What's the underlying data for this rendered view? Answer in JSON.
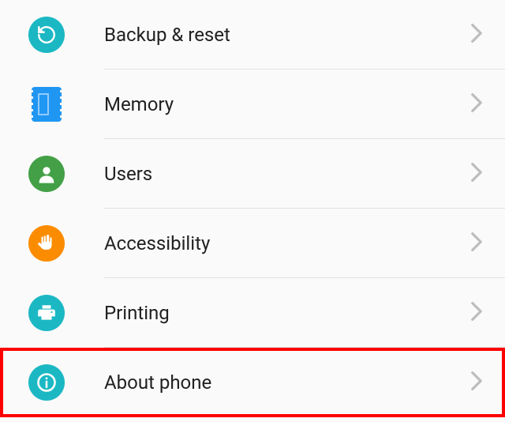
{
  "settings": {
    "items": [
      {
        "key": "backup-reset",
        "label": "Backup & reset",
        "icon": "refresh-icon",
        "color": "cyan"
      },
      {
        "key": "memory",
        "label": "Memory",
        "icon": "memory-icon",
        "color": "blue"
      },
      {
        "key": "users",
        "label": "Users",
        "icon": "user-icon",
        "color": "green"
      },
      {
        "key": "accessibility",
        "label": "Accessibility",
        "icon": "hand-icon",
        "color": "orange"
      },
      {
        "key": "printing",
        "label": "Printing",
        "icon": "print-icon",
        "color": "cyan"
      },
      {
        "key": "about-phone",
        "label": "About phone",
        "icon": "info-icon",
        "color": "cyan",
        "highlighted": true
      }
    ]
  }
}
